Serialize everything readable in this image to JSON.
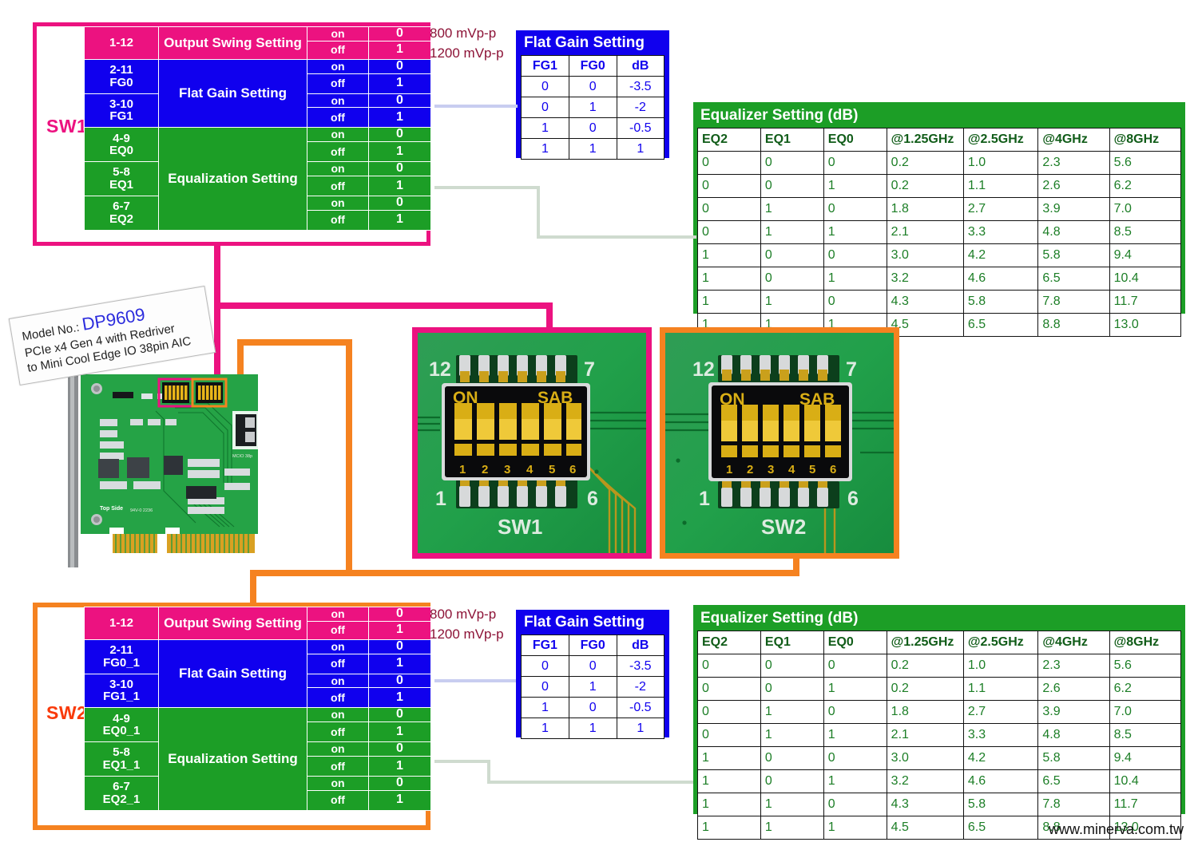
{
  "product": {
    "model_prefix": "Model No.:",
    "model_no": "DP9609",
    "desc_line1": "PCIe x4 Gen 4 with Redriver",
    "desc_line2": "to Mini Cool Edge IO 38pin AIC",
    "pcb_top_side": "Top Side",
    "pcb_ul": "94V-0 2236",
    "pcb_connector": "MCIO 38p"
  },
  "footer": {
    "website": "www.minerva.com.tw"
  },
  "colors": {
    "pink": "#ec1280",
    "blue": "#1000ee",
    "green": "#1c9e26",
    "orange": "#f58220",
    "red": "#f93a0a",
    "maroon": "#8c1236"
  },
  "mv_note": {
    "line1": "800 mVp-p",
    "line2": "1200 mVp-p"
  },
  "switch_groups": [
    {
      "name": "SW1",
      "rows": [
        {
          "pins": "1-12",
          "signal": "",
          "desc": "Output Swing Setting",
          "color": "pink",
          "states": [
            {
              "state": "on",
              "bit": "0"
            },
            {
              "state": "off",
              "bit": "1"
            }
          ]
        },
        {
          "pins": "2-11",
          "signal": "FG0",
          "desc": "Flat Gain Setting",
          "color": "blue",
          "states": [
            {
              "state": "on",
              "bit": "0"
            },
            {
              "state": "off",
              "bit": "1"
            }
          ]
        },
        {
          "pins": "3-10",
          "signal": "FG1",
          "desc": "",
          "color": "blue",
          "states": [
            {
              "state": "on",
              "bit": "0"
            },
            {
              "state": "off",
              "bit": "1"
            }
          ]
        },
        {
          "pins": "4-9",
          "signal": "EQ0",
          "desc": "Equalization Setting",
          "color": "green",
          "states": [
            {
              "state": "on",
              "bit": "0"
            },
            {
              "state": "off",
              "bit": "1"
            }
          ]
        },
        {
          "pins": "5-8",
          "signal": "EQ1",
          "desc": "",
          "color": "green",
          "states": [
            {
              "state": "on",
              "bit": "0"
            },
            {
              "state": "off",
              "bit": "1"
            }
          ]
        },
        {
          "pins": "6-7",
          "signal": "EQ2",
          "desc": "",
          "color": "green",
          "states": [
            {
              "state": "on",
              "bit": "0"
            },
            {
              "state": "off",
              "bit": "1"
            }
          ]
        }
      ]
    },
    {
      "name": "SW2",
      "rows": [
        {
          "pins": "1-12",
          "signal": "",
          "desc": "Output Swing Setting",
          "color": "pink",
          "states": [
            {
              "state": "on",
              "bit": "0"
            },
            {
              "state": "off",
              "bit": "1"
            }
          ]
        },
        {
          "pins": "2-11",
          "signal": "FG0_1",
          "desc": "Flat Gain Setting",
          "color": "blue",
          "states": [
            {
              "state": "on",
              "bit": "0"
            },
            {
              "state": "off",
              "bit": "1"
            }
          ]
        },
        {
          "pins": "3-10",
          "signal": "FG1_1",
          "desc": "",
          "color": "blue",
          "states": [
            {
              "state": "on",
              "bit": "0"
            },
            {
              "state": "off",
              "bit": "1"
            }
          ]
        },
        {
          "pins": "4-9",
          "signal": "EQ0_1",
          "desc": "Equalization Setting",
          "color": "green",
          "states": [
            {
              "state": "on",
              "bit": "0"
            },
            {
              "state": "off",
              "bit": "1"
            }
          ]
        },
        {
          "pins": "5-8",
          "signal": "EQ1_1",
          "desc": "",
          "color": "green",
          "states": [
            {
              "state": "on",
              "bit": "0"
            },
            {
              "state": "off",
              "bit": "1"
            }
          ]
        },
        {
          "pins": "6-7",
          "signal": "EQ2_1",
          "desc": "",
          "color": "green",
          "states": [
            {
              "state": "on",
              "bit": "0"
            },
            {
              "state": "off",
              "bit": "1"
            }
          ]
        }
      ]
    }
  ],
  "flat_gain_table": {
    "title": "Flat Gain Setting",
    "headers": [
      "FG1",
      "FG0",
      "dB"
    ],
    "rows": [
      [
        "0",
        "0",
        "-3.5"
      ],
      [
        "0",
        "1",
        "-2"
      ],
      [
        "1",
        "0",
        "-0.5"
      ],
      [
        "1",
        "1",
        "1"
      ]
    ]
  },
  "equalizer_table": {
    "title": "Equalizer Setting (dB)",
    "headers": [
      "EQ2",
      "EQ1",
      "EQ0",
      "@1.25GHz",
      "@2.5GHz",
      "@4GHz",
      "@8GHz"
    ],
    "rows": [
      [
        "0",
        "0",
        "0",
        "0.2",
        "1.0",
        "2.3",
        "5.6"
      ],
      [
        "0",
        "0",
        "1",
        "0.2",
        "1.1",
        "2.6",
        "6.2"
      ],
      [
        "0",
        "1",
        "0",
        "1.8",
        "2.7",
        "3.9",
        "7.0"
      ],
      [
        "0",
        "1",
        "1",
        "2.1",
        "3.3",
        "4.8",
        "8.5"
      ],
      [
        "1",
        "0",
        "0",
        "3.0",
        "4.2",
        "5.8",
        "9.4"
      ],
      [
        "1",
        "0",
        "1",
        "3.2",
        "4.6",
        "6.5",
        "10.4"
      ],
      [
        "1",
        "1",
        "0",
        "4.3",
        "5.8",
        "7.8",
        "11.7"
      ],
      [
        "1",
        "1",
        "1",
        "4.5",
        "6.5",
        "8.8",
        "13.0"
      ]
    ]
  },
  "dip_photos": [
    {
      "name": "SW1",
      "top_left_pin": "12",
      "top_right_pin": "7",
      "bottom_left_pin": "1",
      "bottom_right_pin": "6",
      "body_left": "ON",
      "body_right": "SAB",
      "switch_numbers": [
        "1",
        "2",
        "3",
        "4",
        "5",
        "6"
      ],
      "silkscreen": "SW1"
    },
    {
      "name": "SW2",
      "top_left_pin": "12",
      "top_right_pin": "7",
      "bottom_left_pin": "1",
      "bottom_right_pin": "6",
      "body_left": "ON",
      "body_right": "SAB",
      "switch_numbers": [
        "1",
        "2",
        "3",
        "4",
        "5",
        "6"
      ],
      "silkscreen": "SW2"
    }
  ]
}
